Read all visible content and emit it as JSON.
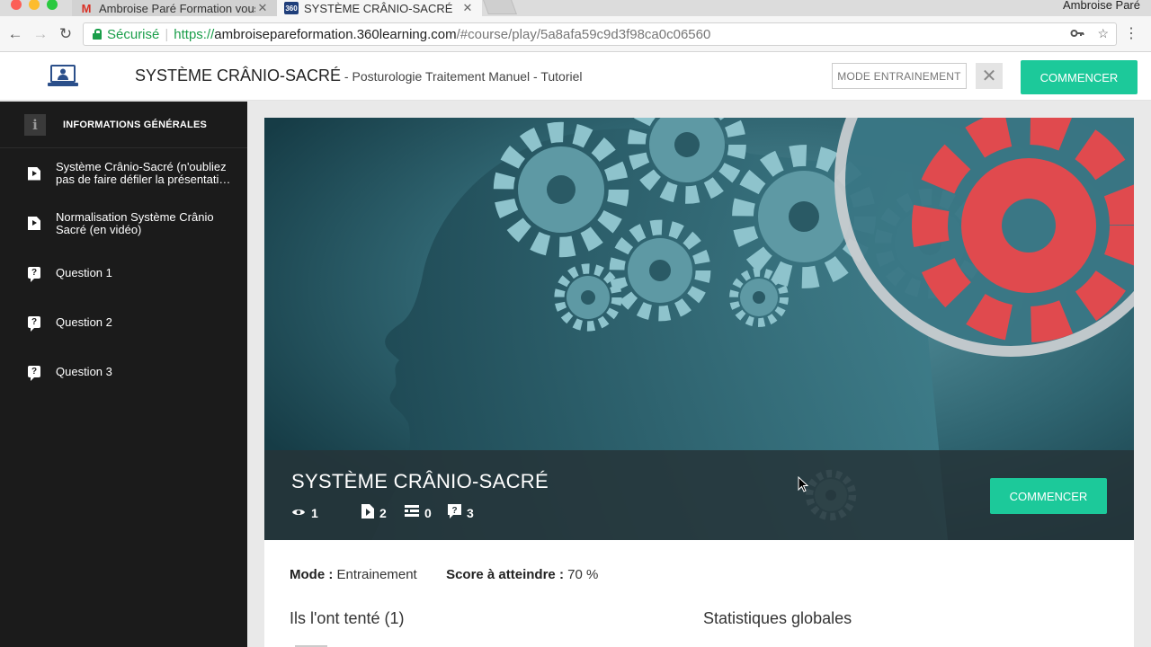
{
  "browser": {
    "tabs": [
      {
        "title": "Ambroise Paré Formation vous",
        "favicon": "gmail-icon"
      },
      {
        "title": "SYSTÈME CRÂNIO-SACRÉ",
        "favicon": "360-icon",
        "favicon_text": "360"
      }
    ],
    "profile_name": "Ambroise Paré",
    "secure_label": "Sécurisé",
    "url": {
      "protocol": "https://",
      "host": "ambroisepareformation.360learning.com",
      "path": "/#course/play/5a8afa59c9d3f98ca0c06560"
    }
  },
  "header": {
    "title": "SYSTÈME CRÂNIO-SACRÉ",
    "subtitle": " - Posturologie Traitement Manuel - Tutoriel",
    "mode_button": "MODE ENTRAINEMENT",
    "close_symbol": "✕",
    "start_button": "COMMENCER"
  },
  "sidebar": {
    "info_icon_text": "i",
    "info_label": "INFORMATIONS GÉNÉRALES",
    "items": [
      {
        "type": "video",
        "icon": "play-icon",
        "label": "Système Crânio-Sacré (n'oubliez pas de faire défiler la présentati…"
      },
      {
        "type": "video",
        "icon": "play-icon",
        "label": "Normalisation Système Crânio Sacré (en vidéo)"
      },
      {
        "type": "question",
        "icon": "question-icon",
        "icon_text": "?",
        "label": "Question 1"
      },
      {
        "type": "question",
        "icon": "question-icon",
        "icon_text": "?",
        "label": "Question 2"
      },
      {
        "type": "question",
        "icon": "question-icon",
        "icon_text": "?",
        "label": "Question 3"
      }
    ]
  },
  "hero": {
    "title": "SYSTÈME CRÂNIO-SACRÉ",
    "stats": {
      "views": "1",
      "videos": "2",
      "docs": "0",
      "questions": "3"
    },
    "start_button": "COMMENCER"
  },
  "details": {
    "mode_label": "Mode :",
    "mode_value": "Entrainement",
    "score_label": "Score à atteindre :",
    "score_value": "70 %",
    "attempted_heading": "Ils l'ont tenté (1)",
    "stats_heading": "Statistiques globales"
  },
  "colors": {
    "accent": "#1cc99a",
    "sidebar_bg": "#1b1b1b",
    "secure_green": "#1a9e4a"
  }
}
